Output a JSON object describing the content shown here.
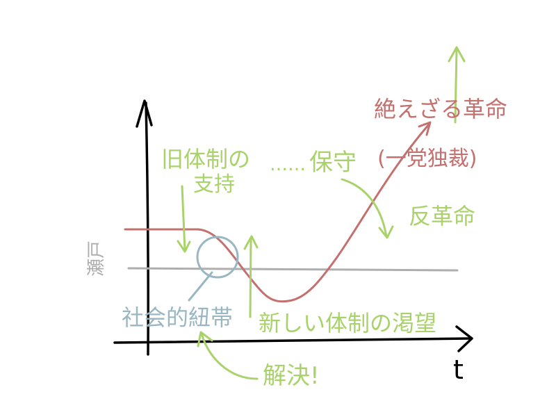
{
  "colors": {
    "axis": "#000000",
    "curve": "#c4706e",
    "baseline": "#aeaeae",
    "annotation": "#a9d36a",
    "circle": "#99b7c2"
  },
  "labels": {
    "threshold": "瀬戸",
    "t_axis": "t",
    "old_support": "旧体制の",
    "old_support_2": "支持",
    "ellipsis": "……",
    "conserve": "保守",
    "counter_revolution": "反革命",
    "permanent_revolution": "絶えざる革命",
    "dictatorship": "(一党独裁)",
    "new_system_desire": "新しい体制の渇望",
    "social_ties": "社会的紐帯",
    "liberation": "解決!"
  }
}
